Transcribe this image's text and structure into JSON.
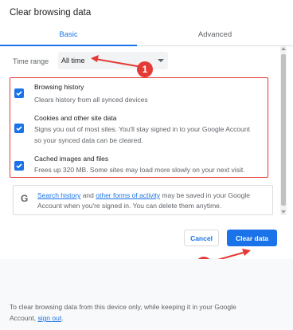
{
  "dialog": {
    "title": "Clear browsing data"
  },
  "tabs": [
    {
      "label": "Basic",
      "selected": true
    },
    {
      "label": "Advanced",
      "selected": false
    }
  ],
  "time_range": {
    "label": "Time range",
    "value": "All time"
  },
  "options": [
    {
      "title": "Browsing history",
      "desc_lines": [
        "Clears history from all synced devices"
      ],
      "checked": true
    },
    {
      "title": "Cookies and other site data",
      "desc_lines": [
        "Signs you out of most sites. You'll stay signed in to your Google Account",
        "so your synced data can be cleared."
      ],
      "checked": true
    },
    {
      "title": "Cached images and files",
      "desc_lines": [
        "Frees up 320 MB. Some sites may load more slowly on your next visit."
      ],
      "checked": true
    }
  ],
  "info": {
    "icon": "G",
    "link1": "Search history",
    "and": " and ",
    "link2": "other forms of activity",
    "rest1": " may be saved in your Google",
    "line2": "Account when you're signed in. You can delete them anytime."
  },
  "buttons": {
    "cancel": "Cancel",
    "clear": "Clear data"
  },
  "footer": {
    "text1": "To clear browsing data from this device only, while keeping it in your Google",
    "text2_prefix": "Account, ",
    "sign_out": "sign out",
    "text2_suffix": "."
  },
  "annotations": {
    "badge1": "1",
    "badge2": "2"
  },
  "colors": {
    "accent": "#1a73e8",
    "annotation_red": "#e53935"
  }
}
